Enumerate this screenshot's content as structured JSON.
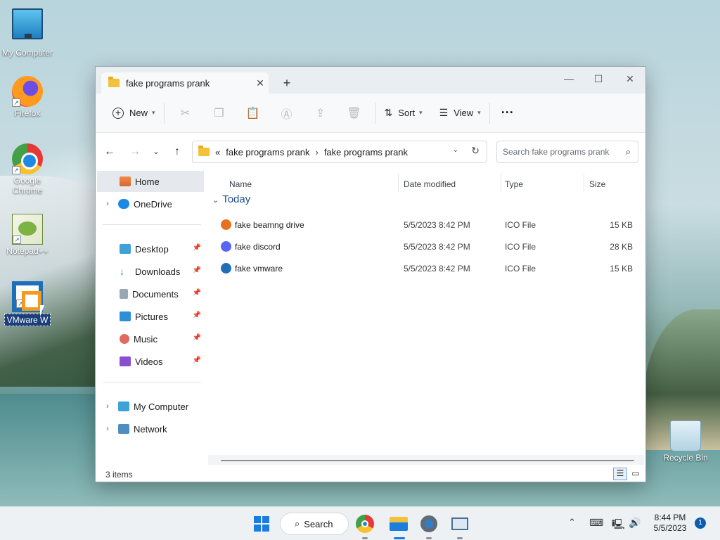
{
  "desktop": {
    "icons": [
      {
        "label": "My Computer"
      },
      {
        "label": "Firefox"
      },
      {
        "label": "Google Chrome"
      },
      {
        "label": "Notepad++"
      },
      {
        "label": "VMware W"
      },
      {
        "label": "Recycle Bin"
      }
    ]
  },
  "window": {
    "tab_title": "fake programs prank",
    "new_tab": "+",
    "controls": {
      "minimize": "—",
      "maximize": "☐",
      "close": "✕"
    },
    "toolbar": {
      "new_label": "New",
      "sort_label": "Sort",
      "view_label": "View",
      "more_label": "···"
    },
    "address": {
      "overflow": "«",
      "crumbs": [
        "fake programs prank",
        "fake programs prank"
      ],
      "separator": "›"
    },
    "search": {
      "placeholder": "Search fake programs prank"
    },
    "sidebar": {
      "home": "Home",
      "onedrive": "OneDrive",
      "quick": [
        "Desktop",
        "Downloads",
        "Documents",
        "Pictures",
        "Music",
        "Videos"
      ],
      "my_computer": "My Computer",
      "network": "Network"
    },
    "columns": {
      "name": "Name",
      "date": "Date modified",
      "type": "Type",
      "size": "Size"
    },
    "group": "Today",
    "files": [
      {
        "name": "fake beamng drive",
        "date": "5/5/2023 8:42 PM",
        "type": "ICO File",
        "size": "15 KB",
        "color": "#e8711f"
      },
      {
        "name": "fake discord",
        "date": "5/5/2023 8:42 PM",
        "type": "ICO File",
        "size": "28 KB",
        "color": "#5865f2"
      },
      {
        "name": "fake vmware",
        "date": "5/5/2023 8:42 PM",
        "type": "ICO File",
        "size": "15 KB",
        "color": "#1e6fb8"
      }
    ],
    "status": {
      "count": "3 items"
    }
  },
  "taskbar": {
    "search_label": "Search",
    "time": "8:44 PM",
    "date": "5/5/2023",
    "notifications": "1"
  },
  "colors": {
    "accent": "#1a7de0",
    "folder": "#f2c23d"
  }
}
